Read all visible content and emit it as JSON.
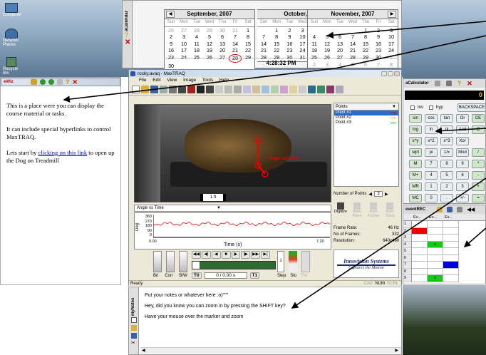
{
  "desktop": {
    "icons": [
      "Computer",
      "Network Places",
      "Recycle Bin"
    ]
  },
  "calendar": {
    "side_title": "aCalendar",
    "time": "4:28:32 PM",
    "day_names": [
      "Sun",
      "Mon",
      "Tue",
      "Wed",
      "Thu",
      "Fri",
      "Sat"
    ],
    "months": [
      {
        "name": "September, 2007",
        "rows": [
          [
            "26",
            "27",
            "28",
            "29",
            "30",
            "31",
            "1"
          ],
          [
            "2",
            "3",
            "4",
            "5",
            "6",
            "7",
            "8"
          ],
          [
            "9",
            "10",
            "11",
            "12",
            "13",
            "14",
            "15"
          ],
          [
            "16",
            "17",
            "18",
            "19",
            "20",
            "21",
            "22"
          ],
          [
            "23",
            "24",
            "25",
            "26",
            "27",
            "28",
            "29"
          ],
          [
            "30",
            "",
            "",
            "",
            "",
            "",
            ""
          ]
        ]
      },
      {
        "name": "October, 2007",
        "rows": [
          [
            "",
            "1",
            "2",
            "3",
            "4",
            "5",
            "6"
          ],
          [
            "7",
            "8",
            "9",
            "10",
            "11",
            "12",
            "13"
          ],
          [
            "14",
            "15",
            "16",
            "17",
            "18",
            "19",
            "20"
          ],
          [
            "21",
            "22",
            "23",
            "24",
            "25",
            "26",
            "27"
          ],
          [
            "28",
            "29",
            "30",
            "31",
            "",
            "",
            ""
          ]
        ]
      },
      {
        "name": "November, 2007",
        "rows": [
          [
            "",
            "",
            "",
            "",
            "1",
            "2",
            "3"
          ],
          [
            "4",
            "5",
            "6",
            "7",
            "8",
            "9",
            "10"
          ],
          [
            "11",
            "12",
            "13",
            "14",
            "15",
            "16",
            "17"
          ],
          [
            "18",
            "19",
            "20",
            "21",
            "22",
            "23",
            "24"
          ],
          [
            "25",
            "26",
            "27",
            "28",
            "29",
            "30",
            "1"
          ],
          [
            "2",
            "3",
            "4",
            "5",
            "6",
            "7",
            "8"
          ]
        ]
      }
    ],
    "today": "28"
  },
  "wiz": {
    "title": "eWiz",
    "para1": "This is a place were you can display the course material or tasks.",
    "para2": "It can include special hyperlinks to control MaxTRAQ.",
    "para3_pre": "Lets start by ",
    "para3_link": "clicking on this link",
    "para3_post": " to open up the Dog on Treadmill"
  },
  "maxtraq": {
    "title": "rocky.avaq - MaxTRAQ",
    "menu": [
      "File",
      "Edit",
      "View",
      "Image",
      "Tools",
      "Help"
    ],
    "points_dropdown": "Points",
    "points": [
      "Point #1",
      "Point #2",
      "Point #3"
    ],
    "number_of_points_label": "Number of Points",
    "number_of_points": "3",
    "angle_label": "Angle #1=140.1",
    "scale_label": "1 ft",
    "graph_dropdown": "Angle vs Time",
    "graph_ylabel": "Deg",
    "graph_xlabel": "Time (s)",
    "graph_yticks": [
      "360",
      "270",
      "180",
      "90",
      "0"
    ],
    "graph_x0": "0.00",
    "graph_x1": "7.20",
    "digitize_buttons": [
      "Digitize",
      "Auto Point",
      "Auto Frame",
      "Auto Track"
    ],
    "frame_rate_label": "Frame Rate:",
    "frame_rate": "46 Hz",
    "frames_label": "No of Frames:",
    "frames": "332",
    "resolution_label": "Resolution:",
    "resolution": "640x480",
    "slider_labels": [
      "Bri",
      "Con",
      "B/W"
    ],
    "t0": "T0",
    "t1": "T1",
    "frame_counter": "0 / 0.00 s",
    "step_label": "Step",
    "slo_label": "Slo",
    "thr_label": "Thr",
    "step_value": "1",
    "status_ready": "Ready",
    "status_cap": "CAP",
    "status_num": "NUM",
    "status_scrl": "SCRL",
    "logo_line1": "Innovision Systems",
    "logo_line2": "Captures the Motion"
  },
  "calculator": {
    "title": "aCalculator",
    "display": "0",
    "inv": "Inv",
    "hyp": "hyp",
    "backspace": "BACKSPACE",
    "rows": [
      [
        "sin",
        "cos",
        "tan",
        "Or",
        "CE"
      ],
      [
        "log",
        "ln",
        "nl",
        "And",
        "C"
      ],
      [
        "x^y",
        "x^2",
        "x^3",
        "Xor",
        ""
      ],
      [
        "sqrt",
        "pi",
        "1/x",
        "Mod",
        "/"
      ],
      [
        "M",
        "7",
        "8",
        "9",
        "*"
      ],
      [
        "M+",
        "4",
        "5",
        "6",
        "-"
      ],
      [
        "MR",
        "1",
        "2",
        "3",
        "+"
      ],
      [
        "MC",
        "0",
        ".",
        "+/-",
        "="
      ]
    ]
  },
  "events": {
    "title": "eventREC",
    "headers": [
      "Ev...",
      "Ev...",
      "Ev..."
    ],
    "rows": [
      "1",
      "2",
      "3",
      "4",
      "5",
      "6",
      "7",
      "8",
      "9"
    ],
    "cell_x": "x"
  },
  "notes": {
    "side_title": "myNotes",
    "line1": "Put your notes or whatever here :o)\"\"\"",
    "line2": "Hey, did you know you can zoom in by pressing the SHIFT key?",
    "line3": "Have your mouse over the marker and zoom"
  }
}
